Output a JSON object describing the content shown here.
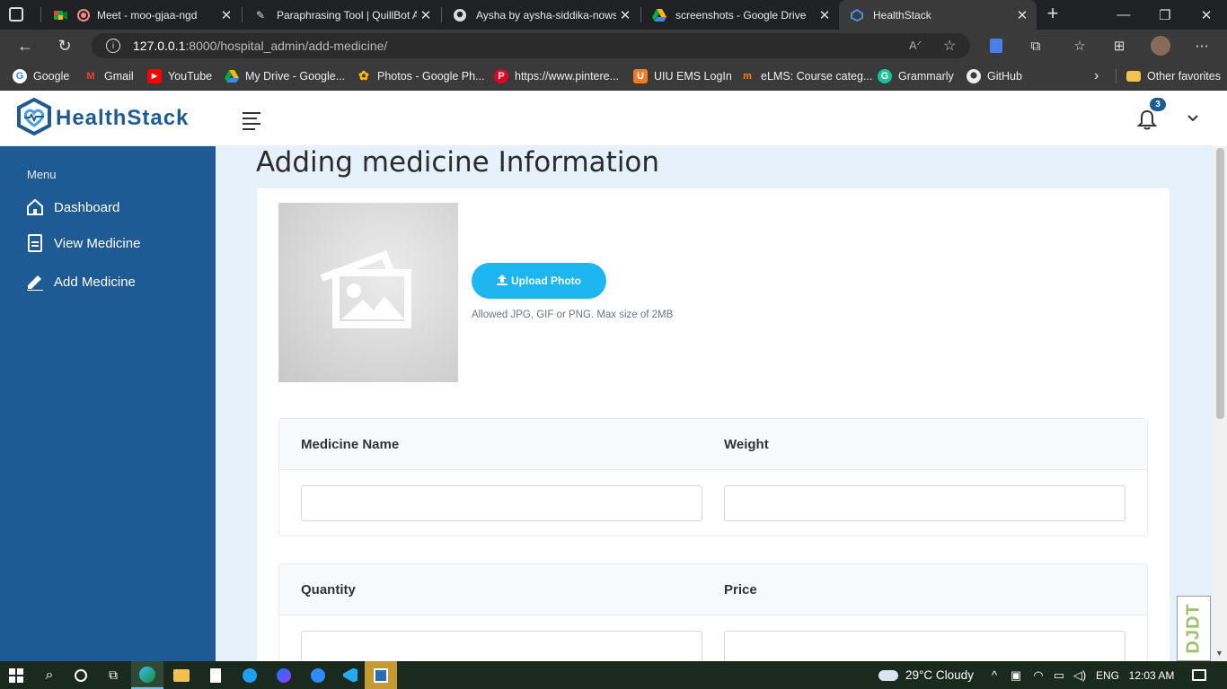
{
  "tabs": [
    {
      "label": "Meet - moo-gjaa-ngd",
      "icon": "google-meet-icon"
    },
    {
      "label": "Paraphrasing Tool | QuillBot AI",
      "icon": "quillbot-icon"
    },
    {
      "label": "Aysha by aysha-siddika-nowshin",
      "icon": "github-icon"
    },
    {
      "label": "screenshots - Google Drive",
      "icon": "google-drive-icon"
    },
    {
      "label": "HealthStack",
      "icon": "healthstack-icon"
    }
  ],
  "address": {
    "host": "127.0.0.1",
    "path": ":8000/hospital_admin/add-medicine/"
  },
  "bookmarks": [
    "Google",
    "Gmail",
    "YouTube",
    "My Drive - Google...",
    "Photos - Google Ph...",
    "https://www.pintere...",
    "UIU EMS LogIn",
    "eLMS: Course categ...",
    "Grammarly",
    "GitHub"
  ],
  "other_favorites": "Other favorites",
  "app": {
    "brand": "HealthStack",
    "notification_count": "3"
  },
  "sidebar": {
    "heading": "Menu",
    "items": [
      {
        "label": "Dashboard",
        "icon": "home-icon"
      },
      {
        "label": "View Medicine",
        "icon": "document-icon"
      },
      {
        "label": "Add Medicine",
        "icon": "pencil-icon"
      }
    ]
  },
  "main": {
    "title": "Adding medicine Information",
    "upload_label": "Upload Photo",
    "upload_hint": "Allowed JPG, GIF or PNG. Max size of 2MB",
    "fields": {
      "medicine_name": "Medicine Name",
      "weight": "Weight",
      "quantity": "Quantity",
      "price": "Price"
    }
  },
  "watermark": "DJDT",
  "taskbar": {
    "weather": "29°C  Cloudy",
    "lang": "ENG",
    "time": "12:03 AM"
  },
  "colors": {
    "sidebar": "#1e5b94",
    "accent": "#1eb6f0",
    "content_bg": "#e6f1fc",
    "brand": "#1e5b94"
  }
}
